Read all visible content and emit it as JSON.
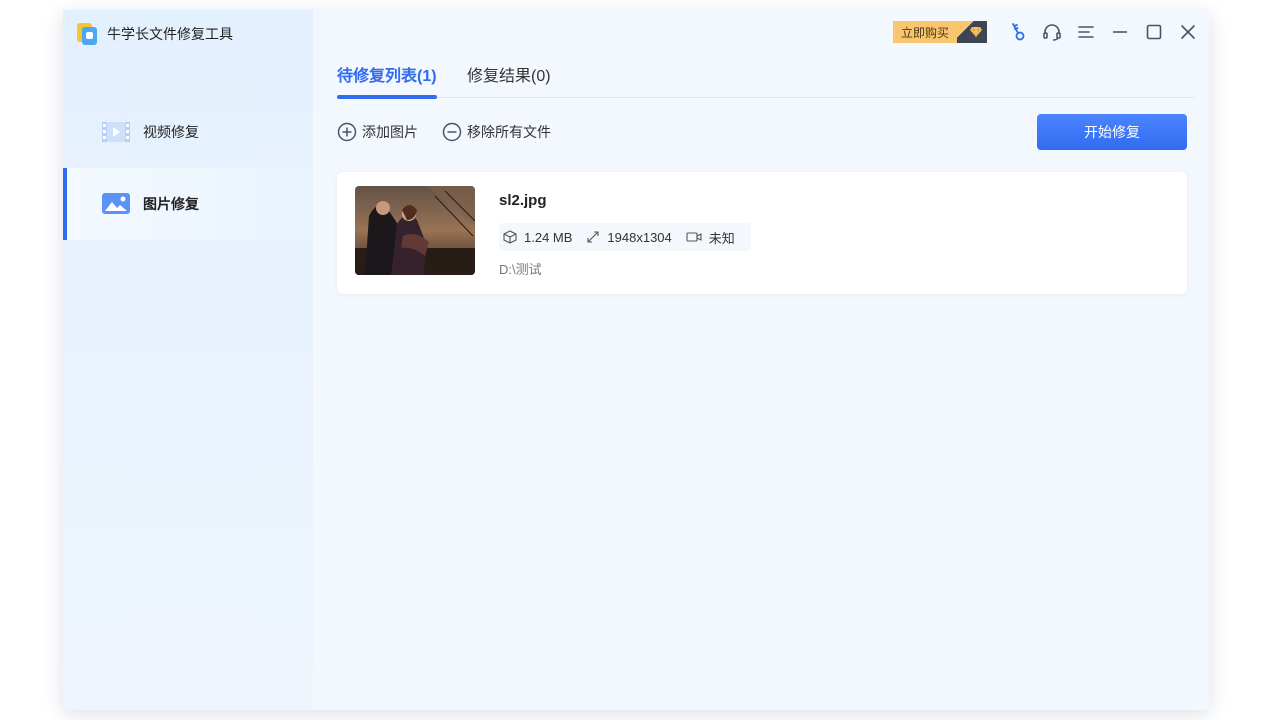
{
  "app": {
    "title": "牛学长文件修复工具"
  },
  "sidebar": {
    "items": [
      {
        "label": "视频修复",
        "icon": "video-icon",
        "active": false
      },
      {
        "label": "图片修复",
        "icon": "image-icon",
        "active": true
      }
    ]
  },
  "titlebar": {
    "buy_label": "立即购买",
    "icons": [
      "diamond-icon",
      "key-icon",
      "headset-icon",
      "menu-icon",
      "minimize-icon",
      "maximize-icon",
      "close-icon"
    ]
  },
  "tabs": [
    {
      "label": "待修复列表(1)",
      "active": true
    },
    {
      "label": "修复结果(0)",
      "active": false
    }
  ],
  "toolbar": {
    "add_label": "添加图片",
    "remove_label": "移除所有文件",
    "start_label": "开始修复"
  },
  "files": [
    {
      "name": "sl2.jpg",
      "size": "1.24 MB",
      "resolution": "1948x1304",
      "duration": "未知",
      "path": "D:\\测试"
    }
  ],
  "colors": {
    "accent": "#2f6cf0",
    "badge": "#f9c66f",
    "badge_dark": "#3d4453"
  }
}
